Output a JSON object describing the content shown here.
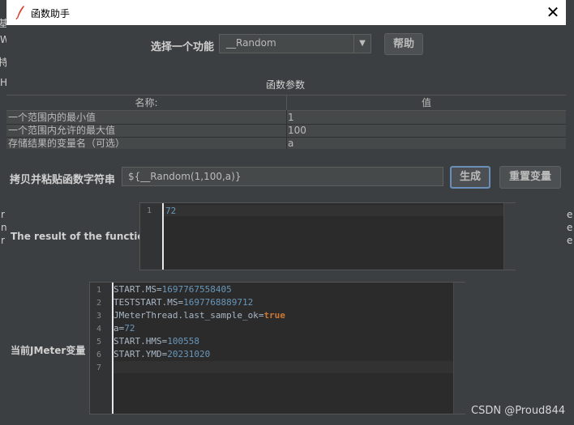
{
  "dialog": {
    "title": "函数助手",
    "close_glyph": "✕"
  },
  "background": {
    "frag_letters": [
      "基",
      "W",
      "持",
      "H",
      "r",
      "n",
      "r",
      "r"
    ],
    "frag_right": [
      "e",
      "e",
      "e"
    ]
  },
  "function_select": {
    "label": "选择一个功能",
    "value": "__Random",
    "arrow": "▼"
  },
  "help_button": "帮助",
  "params": {
    "section_title": "函数参数",
    "headers": [
      "名称:",
      "值"
    ],
    "rows": [
      {
        "name": "一个范围内的最小值",
        "value": "1"
      },
      {
        "name": "一个范围内允许的最大值",
        "value": "100"
      },
      {
        "name": "存储结果的变量名（可选）",
        "value": "a"
      }
    ]
  },
  "copy": {
    "label": "拷贝并粘贴函数字符串",
    "value": "${__Random(1,100,a)}"
  },
  "generate_button": "生成",
  "reset_button": "重置变量",
  "result": {
    "label": "The result of the function is",
    "line_numbers": [
      "1"
    ],
    "text": "72"
  },
  "vars": {
    "label": "当前JMeter变量",
    "line_numbers": [
      "1",
      "2",
      "3",
      "4",
      "5",
      "6",
      "7"
    ],
    "lines": [
      {
        "key": "START.MS",
        "eq": "=",
        "val": "1697767558405",
        "kind": "num"
      },
      {
        "key": "TESTSTART.MS",
        "eq": "=",
        "val": "1697768889712",
        "kind": "num"
      },
      {
        "key": "JMeterThread.last_sample_ok",
        "eq": "=",
        "val": "true",
        "kind": "kw"
      },
      {
        "key": "a",
        "eq": "=",
        "val": "72",
        "kind": "num"
      },
      {
        "key": "START.HMS",
        "eq": "=",
        "val": "100558",
        "kind": "num"
      },
      {
        "key": "START.YMD",
        "eq": "=",
        "val": "20231020",
        "kind": "num"
      },
      {
        "key": "",
        "eq": "",
        "val": "",
        "kind": "num"
      }
    ]
  },
  "watermark": "CSDN @Proud844",
  "colors": {
    "panel": "#3c3f41",
    "editor": "#2b2b2b",
    "number": "#6897bb",
    "keyword": "#cc7832",
    "focus_border": "#6a8fb8"
  }
}
